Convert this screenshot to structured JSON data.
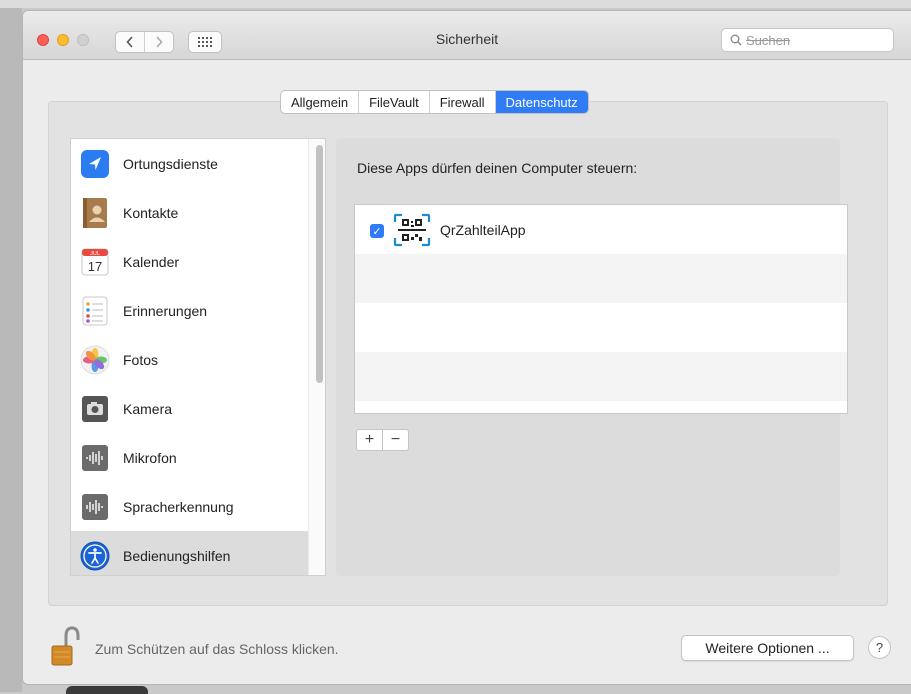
{
  "window": {
    "title": "Sicherheit"
  },
  "toolbar": {
    "back_icon": "chevron-left-icon",
    "forward_icon": "chevron-right-icon",
    "grid_icon": "show-all-grid-icon",
    "search_placeholder": "Suchen"
  },
  "tabs": [
    {
      "label": "Allgemein",
      "active": false
    },
    {
      "label": "FileVault",
      "active": false
    },
    {
      "label": "Firewall",
      "active": false
    },
    {
      "label": "Datenschutz",
      "active": true
    }
  ],
  "sidebar": {
    "items": [
      {
        "label": "Ortungsdienste",
        "icon": "location-arrow-icon"
      },
      {
        "label": "Kontakte",
        "icon": "contacts-icon"
      },
      {
        "label": "Kalender",
        "icon": "calendar-icon"
      },
      {
        "label": "Erinnerungen",
        "icon": "reminders-icon"
      },
      {
        "label": "Fotos",
        "icon": "photos-icon"
      },
      {
        "label": "Kamera",
        "icon": "camera-icon"
      },
      {
        "label": "Mikrofon",
        "icon": "microphone-icon"
      },
      {
        "label": "Spracherkennung",
        "icon": "speech-recognition-icon"
      },
      {
        "label": "Bedienungshilfen",
        "icon": "accessibility-icon",
        "selected": true
      }
    ]
  },
  "calendar_icon": {
    "month": "JUL",
    "day": "17"
  },
  "main": {
    "title": "Diese Apps dürfen deinen Computer steuern:",
    "apps": [
      {
        "name": "QrZahlteilApp",
        "checked": true,
        "icon": "qr-code-icon"
      }
    ],
    "add_label": "+",
    "remove_label": "−"
  },
  "footer": {
    "lock_text": "Zum Schützen auf das Schloss klicken.",
    "more_options": "Weitere Optionen ...",
    "help": "?"
  },
  "colors": {
    "accent": "#2f7cf6",
    "selected_row": "#dcdcdc"
  }
}
